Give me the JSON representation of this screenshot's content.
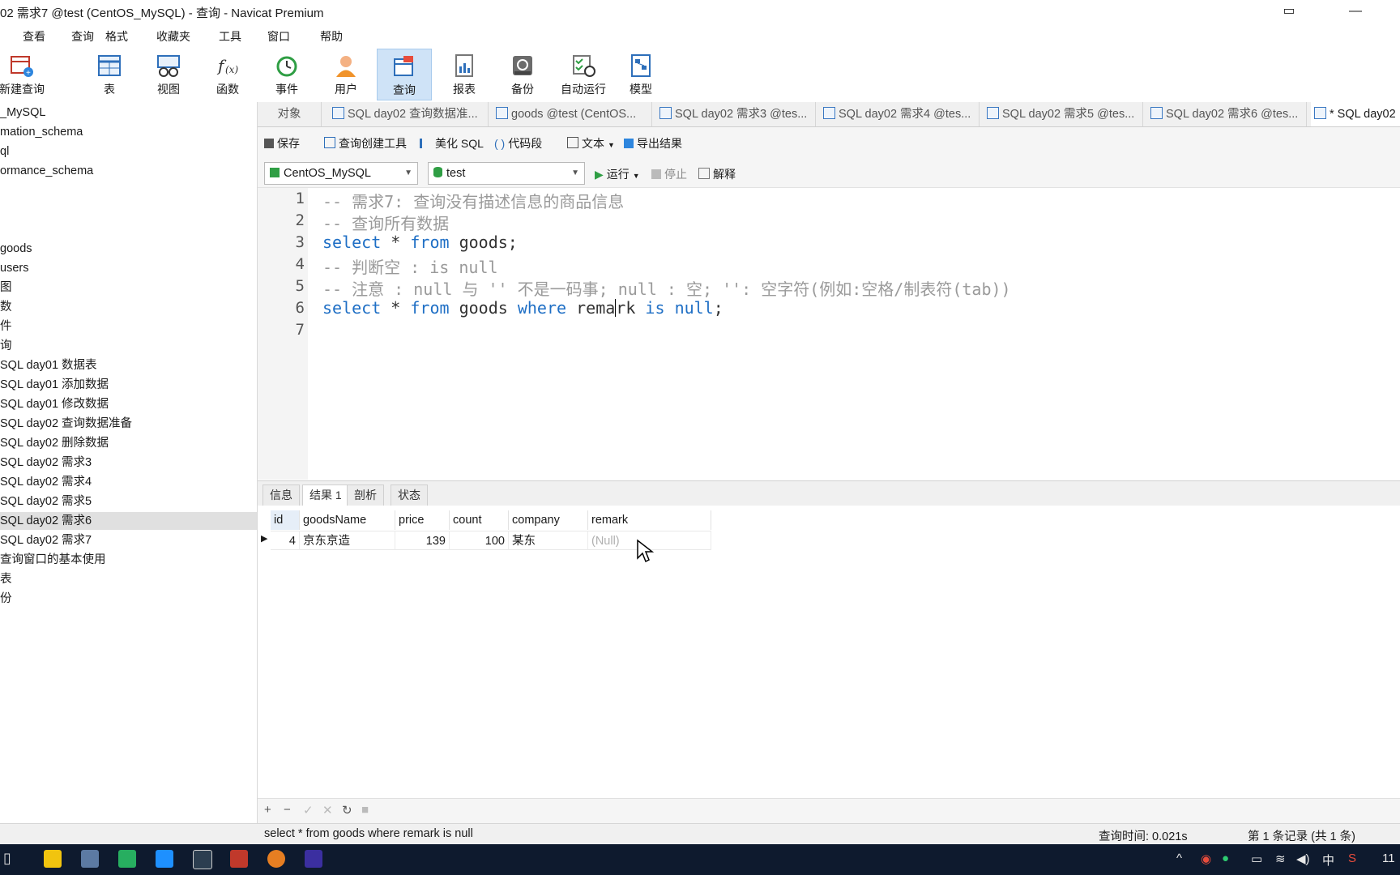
{
  "window": {
    "title": "02 需求7 @test (CentOS_MySQL) - 查询 - Navicat Premium"
  },
  "menu": [
    "查看",
    "查询",
    "格式",
    "收藏夹",
    "工具",
    "窗口",
    "帮助"
  ],
  "ribbon": [
    {
      "label": "新建查询",
      "icon": "new-query-icon"
    },
    {
      "label": "表",
      "icon": "table-icon"
    },
    {
      "label": "视图",
      "icon": "view-icon"
    },
    {
      "label": "函数",
      "icon": "function-icon"
    },
    {
      "label": "事件",
      "icon": "event-clock-icon"
    },
    {
      "label": "用户",
      "icon": "user-icon"
    },
    {
      "label": "查询",
      "icon": "query-icon"
    },
    {
      "label": "报表",
      "icon": "report-icon"
    },
    {
      "label": "备份",
      "icon": "backup-icon"
    },
    {
      "label": "自动运行",
      "icon": "auto-run-icon"
    },
    {
      "label": "模型",
      "icon": "model-icon"
    }
  ],
  "tree": [
    "_MySQL",
    "mation_schema",
    "ql",
    "ormance_schema",
    "",
    "",
    "",
    "goods",
    "users",
    "图",
    "数",
    "件",
    "询",
    "SQL day01 数据表",
    "SQL day01 添加数据",
    "SQL day01 修改数据",
    "SQL day02 查询数据准备",
    "SQL day02 删除数据",
    "SQL day02 需求3",
    "SQL day02 需求4",
    "SQL day02 需求5",
    "SQL day02 需求6",
    "SQL day02 需求7",
    "查询窗口的基本使用",
    "表",
    "份"
  ],
  "tabs": {
    "objects": "对象",
    "items": [
      "SQL day02 查询数据准...",
      "goods @test (CentOS...",
      "SQL day02 需求3 @tes...",
      "SQL day02 需求4 @tes...",
      "SQL day02 需求5 @tes...",
      "SQL day02 需求6 @tes...",
      "* SQL day02"
    ]
  },
  "toolbar": {
    "save": "保存",
    "query_builder": "查询创建工具",
    "beautify": "美化 SQL",
    "snippet": "代码段",
    "text": "文本",
    "export": "导出结果"
  },
  "connbar": {
    "connection": "CentOS_MySQL",
    "database": "test",
    "run": "运行",
    "stop": "停止",
    "explain": "解释"
  },
  "editor": {
    "line_numbers": [
      "1",
      "2",
      "3",
      "4",
      "5",
      "6",
      "7"
    ],
    "lines": [
      "-- 需求7: 查询没有描述信息的商品信息",
      "-- 查询所有数据",
      "select * from goods;",
      "-- 判断空 : is null",
      "-- 注意 : null 与 '' 不是一码事; null : 空; '': 空字符(例如:空格/制表符(tab))",
      "select * from goods where remark is null;",
      ""
    ],
    "kw_select": "select",
    "kw_from": "from",
    "kw_where": "where",
    "kw_is": "is",
    "kw_null": "null",
    "star": " * ",
    "goods3": " goods;",
    "goods6": " goods ",
    "remark_a": "rema",
    "remark_b": "rk",
    "semicolon": ";"
  },
  "result_tabs": [
    "信息",
    "结果 1",
    "剖析",
    "状态"
  ],
  "grid": {
    "columns": [
      "id",
      "goodsName",
      "price",
      "count",
      "company",
      "remark"
    ],
    "rows": [
      {
        "id": "4",
        "goodsName": "京东京造",
        "price": "139",
        "count": "100",
        "company": "某东",
        "remark": "(Null)"
      }
    ]
  },
  "status": {
    "sql": "select * from goods where remark is null",
    "query_time": "查询时间: 0.021s",
    "records": "第 1 条记录 (共 1 条)"
  },
  "taskbar": {
    "ime": "中",
    "clock": "11"
  },
  "colors": {
    "keyword": "#1f6fc5",
    "comment": "#9a9a9a",
    "selection": "#cfe3f7",
    "taskbar": "#0e1a2e"
  }
}
